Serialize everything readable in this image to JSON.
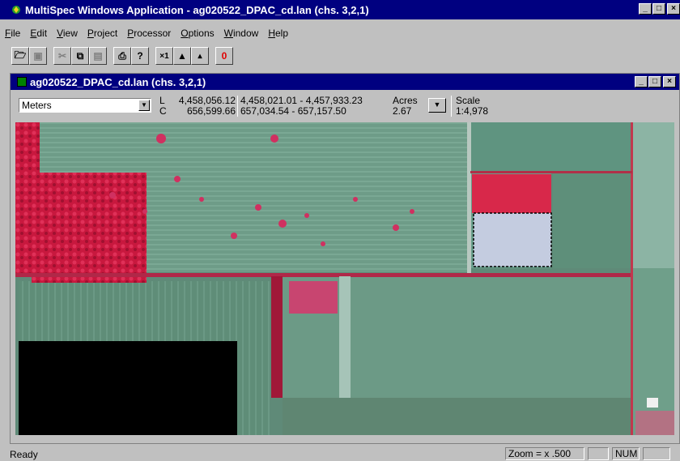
{
  "window": {
    "title": "MultiSpec Windows Application - ag020522_DPAC_cd.lan (chs. 3,2,1)",
    "min_label": "_",
    "max_label": "□",
    "close_label": "×"
  },
  "menu": {
    "items": [
      "File",
      "Edit",
      "View",
      "Project",
      "Processor",
      "Options",
      "Window",
      "Help"
    ]
  },
  "toolbar": {
    "buttons": [
      {
        "icon": "open-folder-icon",
        "glyph": "🗁"
      },
      {
        "icon": "save-disk-icon",
        "glyph": "▣"
      },
      {
        "icon": "cut-scissors-icon",
        "glyph": "✂"
      },
      {
        "icon": "copy-icon",
        "glyph": "⧉"
      },
      {
        "icon": "paste-clipboard-icon",
        "glyph": "▤"
      },
      {
        "icon": "print-printer-icon",
        "glyph": "⎙"
      },
      {
        "icon": "help-question-icon",
        "glyph": "?"
      },
      {
        "icon": "zoom-x1-icon",
        "glyph": "×1"
      },
      {
        "icon": "zoom-in-mountain-icon",
        "glyph": "▲"
      },
      {
        "icon": "zoom-out-mountain-icon",
        "glyph": "▴"
      },
      {
        "icon": "overlay-red-icon",
        "glyph": "0"
      }
    ]
  },
  "image_window": {
    "title": "ag020522_DPAC_cd.lan (chs. 3,2,1)",
    "units": "Meters",
    "line_label": "L",
    "column_label": "C",
    "cursor_line": "4,458,056.12",
    "cursor_column": "656,599.66",
    "selection_line": "4,458,021.01 - 4,457,933.23",
    "selection_column": "657,034.54 - 657,157.50",
    "area_units": "Acres",
    "area_value": "2.67",
    "scale_label": "Scale",
    "scale_value": "1:4,978"
  },
  "status": {
    "text": "Ready",
    "zoom": "Zoom = x .500",
    "num": "NUM"
  },
  "colors": {
    "title_active": "#000080",
    "chrome": "#c0c0c0",
    "vegetation_red": "#d0204a",
    "field_green": "#6f9f8a"
  }
}
